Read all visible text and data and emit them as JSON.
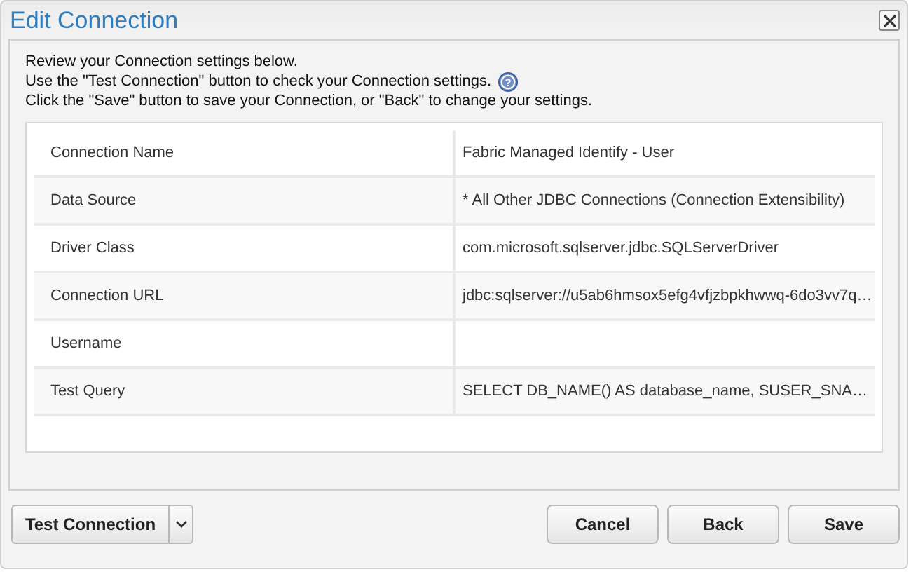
{
  "window": {
    "title": "Edit Connection"
  },
  "instructions": [
    "Review your Connection settings below.",
    "Use the \"Test Connection\" button to check your Connection settings.",
    "Click the \"Save\" button to save your Connection, or \"Back\" to change your settings."
  ],
  "rows": [
    {
      "label": "Connection Name",
      "value": "Fabric Managed Identify - User"
    },
    {
      "label": "Data Source",
      "value": "* All Other JDBC Connections (Connection Extensibility)"
    },
    {
      "label": "Driver Class",
      "value": "com.microsoft.sqlserver.jdbc.SQLServerDriver"
    },
    {
      "label": "Connection URL",
      "value": "jdbc:sqlserver://u5ab6hmsox5efg4vfjzbpkhwwq-6do3vv7q…"
    },
    {
      "label": "Username"
    },
    {
      "label": "Test Query",
      "value": "SELECT DB_NAME() AS database_name,  SUSER_SNA…"
    }
  ],
  "help_icon": "?",
  "test_button": "Test Connection",
  "buttons": [
    "Cancel",
    "Back",
    "Save"
  ]
}
